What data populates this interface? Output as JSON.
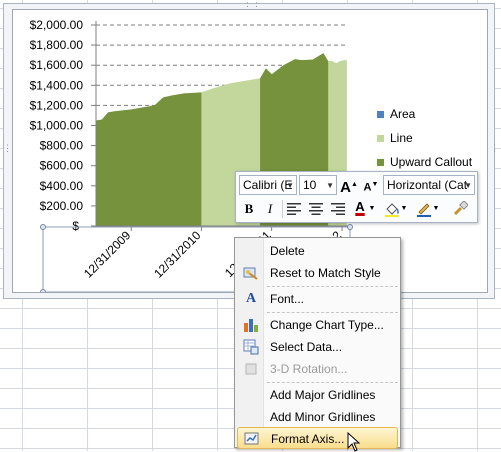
{
  "chart_data": {
    "type": "area",
    "title": "",
    "xlabel": "",
    "ylabel": "",
    "ylim": [
      0,
      2000
    ],
    "y_tick_labels": [
      "$-",
      "$200.00",
      "$400.00",
      "$600.00",
      "$800.00",
      "$1,000.00",
      "$1,200.00",
      "$1,400.00",
      "$1,600.00",
      "$1,800.00",
      "$2,000.00"
    ],
    "x_tick_labels": [
      "12/31/2009",
      "12/31/2010",
      "12/31/2011",
      "12/31/2012"
    ],
    "x_range": [
      "2009-07-01",
      "2013-01-31"
    ],
    "grid": "horizontal dashed",
    "legend_placement": "right",
    "series": [
      {
        "name": "Area",
        "color": "#4f81bd",
        "values": []
      },
      {
        "name": "Line",
        "color": "#c3d69b",
        "x": [
          "2010-12-31",
          "2011-03-01",
          "2011-06-01",
          "2011-09-01",
          "2011-11-01",
          "2012-01-01",
          "2012-03-01",
          "2012-05-01",
          "2012-06-01",
          "2012-08-01",
          "2012-09-25",
          "2012-10-20",
          "2012-11-10",
          "2012-12-01",
          "2012-12-20",
          "2013-01-12",
          "2013-01-25"
        ],
        "values": [
          1330,
          1370,
          1420,
          1450,
          1470,
          1510,
          1600,
          1660,
          1650,
          1655,
          1720,
          1640,
          1640,
          1620,
          1640,
          1650,
          1650
        ]
      },
      {
        "name": "Upward Callout",
        "color": "#76923c",
        "segments": [
          {
            "x": [
              "2009-07-01",
              "2009-08-01",
              "2009-09-01",
              "2009-10-01",
              "2009-11-15",
              "2010-01-01",
              "2010-03-01",
              "2010-05-01",
              "2010-06-15",
              "2010-08-01",
              "2010-10-01",
              "2010-12-31"
            ],
            "values": [
              1050,
              1060,
              1130,
              1140,
              1150,
              1160,
              1180,
              1200,
              1280,
              1300,
              1320,
              1330
            ]
          },
          {
            "x": [
              "2011-11-01",
              "2011-12-01",
              "2012-01-01",
              "2012-03-01",
              "2012-05-01",
              "2012-06-01",
              "2012-08-01",
              "2012-09-25",
              "2012-10-20"
            ],
            "values": [
              1470,
              1570,
              1510,
              1600,
              1660,
              1650,
              1655,
              1720,
              1640
            ]
          }
        ]
      }
    ]
  },
  "legend": {
    "items": [
      {
        "label": "Area",
        "color": "#4f81bd"
      },
      {
        "label": "Line",
        "color": "#c3d69b"
      },
      {
        "label": "Upward Callout",
        "color": "#76923c"
      }
    ]
  },
  "mini_toolbar": {
    "font_name": "Calibri (E",
    "font_size": "10",
    "grow_font": "A",
    "shrink_font": "A",
    "text_direction": "Horizontal (Cat",
    "bold": "B",
    "italic": "I",
    "font_color_glyph": "A",
    "font_color_bar": "#c00000",
    "highlight_color_bar": "#f0ea2a"
  },
  "context_menu": {
    "items": [
      {
        "label": "Delete",
        "icon": "none",
        "disabled": false,
        "highlight": false
      },
      {
        "label": "Reset to Match Style",
        "icon": "reset-style-icon",
        "disabled": false,
        "highlight": false
      },
      {
        "label": "Font...",
        "icon": "font-icon",
        "disabled": false,
        "highlight": false
      },
      {
        "label": "Change Chart Type...",
        "icon": "chart-type-icon",
        "disabled": false,
        "highlight": false
      },
      {
        "label": "Select Data...",
        "icon": "select-data-icon",
        "disabled": false,
        "highlight": false
      },
      {
        "label": "3-D Rotation...",
        "icon": "rotation-icon",
        "disabled": true,
        "highlight": false
      },
      {
        "label": "Add Major Gridlines",
        "icon": "none",
        "disabled": false,
        "highlight": false
      },
      {
        "label": "Add Minor Gridlines",
        "icon": "none",
        "disabled": false,
        "highlight": false
      },
      {
        "label": "Format Axis...",
        "icon": "format-axis-icon",
        "disabled": false,
        "highlight": true
      }
    ]
  }
}
